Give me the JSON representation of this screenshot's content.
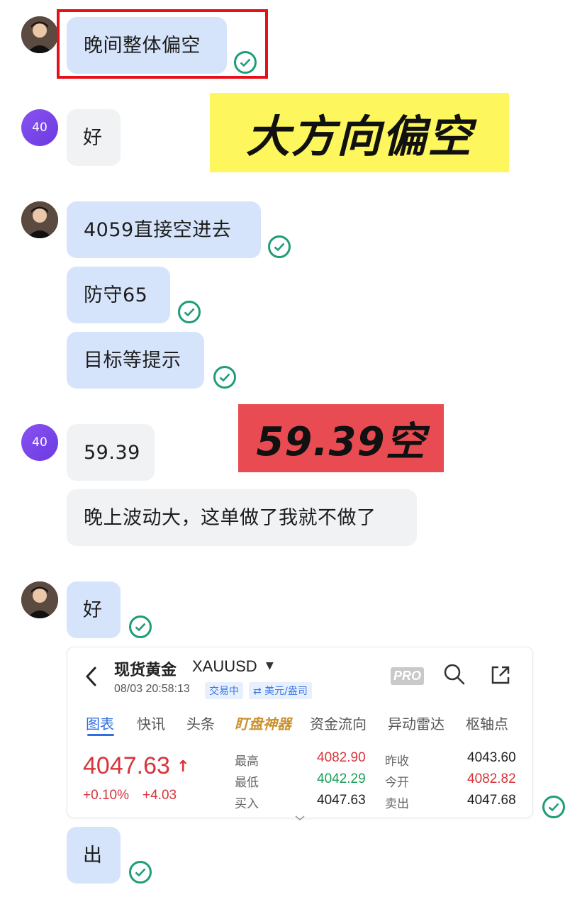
{
  "messages": [
    {
      "id": "m1",
      "text": "晚间整体偏空"
    },
    {
      "id": "m2",
      "avatar_text": "40",
      "text": "好"
    },
    {
      "id": "m3",
      "text": "4059直接空进去"
    },
    {
      "id": "m4",
      "text": "防守65"
    },
    {
      "id": "m5",
      "text": "目标等提示"
    },
    {
      "id": "m6",
      "avatar_text": "40",
      "text": "59.39"
    },
    {
      "id": "m7",
      "text": "晚上波动大，这单做了我就不做了"
    },
    {
      "id": "m8",
      "text": "好"
    },
    {
      "id": "m9",
      "text": "出"
    }
  ],
  "banners": {
    "yellow": "大方向偏空",
    "red": "59.39空"
  },
  "quote_card": {
    "title": "现货黄金",
    "symbol": "XAUUSD",
    "timestamp": "08/03 20:58:13",
    "status_tag": "交易中",
    "currency_tag": "⇄ 美元/盎司",
    "pro_label": "PRO",
    "tabs": [
      "图表",
      "快讯",
      "头条",
      "盯盘神器",
      "资金流向",
      "异动雷达",
      "枢轴点"
    ],
    "price": "4047.63",
    "change_pct": "+0.10%",
    "change_abs": "+4.03",
    "stats": {
      "high_label": "最高",
      "high": "4082.90",
      "low_label": "最低",
      "low": "4042.29",
      "bid_label": "买入",
      "bid": "4047.63",
      "prev_close_label": "昨收",
      "prev_close": "4043.60",
      "open_label": "今开",
      "open": "4082.82",
      "ask_label": "卖出",
      "ask": "4047.68"
    }
  },
  "colors": {
    "my_bubble": "#d6e4fb",
    "their_bubble": "#f1f2f4",
    "check": "#1f9d78",
    "highlight_box": "#e5101a",
    "yellow_banner": "#fdf65c",
    "red_banner": "#e84c52",
    "price_up": "#d6353b",
    "price_down": "#1a9e5a"
  }
}
